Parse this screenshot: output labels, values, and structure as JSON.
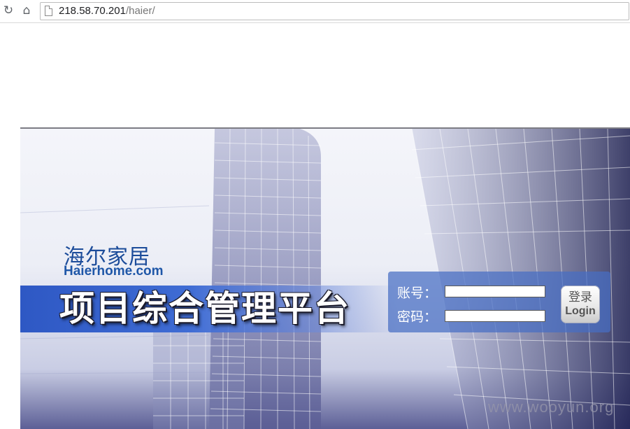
{
  "browser": {
    "url_host": "218.58.70.201",
    "url_path": "/haier/",
    "reload_icon": "↻",
    "home_icon": "⌂"
  },
  "brand": {
    "logo_cn": "海尔家居",
    "logo_en": "Haierhome.com",
    "color": "#1f57a8"
  },
  "page": {
    "title": "项目综合管理平台"
  },
  "login": {
    "account_label": "账号：",
    "password_label": "密码：",
    "account_value": "",
    "password_value": "",
    "button_cn": "登录",
    "button_en": "Login",
    "panel_color": "#466ec3"
  },
  "watermark": "www.wooyun.org"
}
